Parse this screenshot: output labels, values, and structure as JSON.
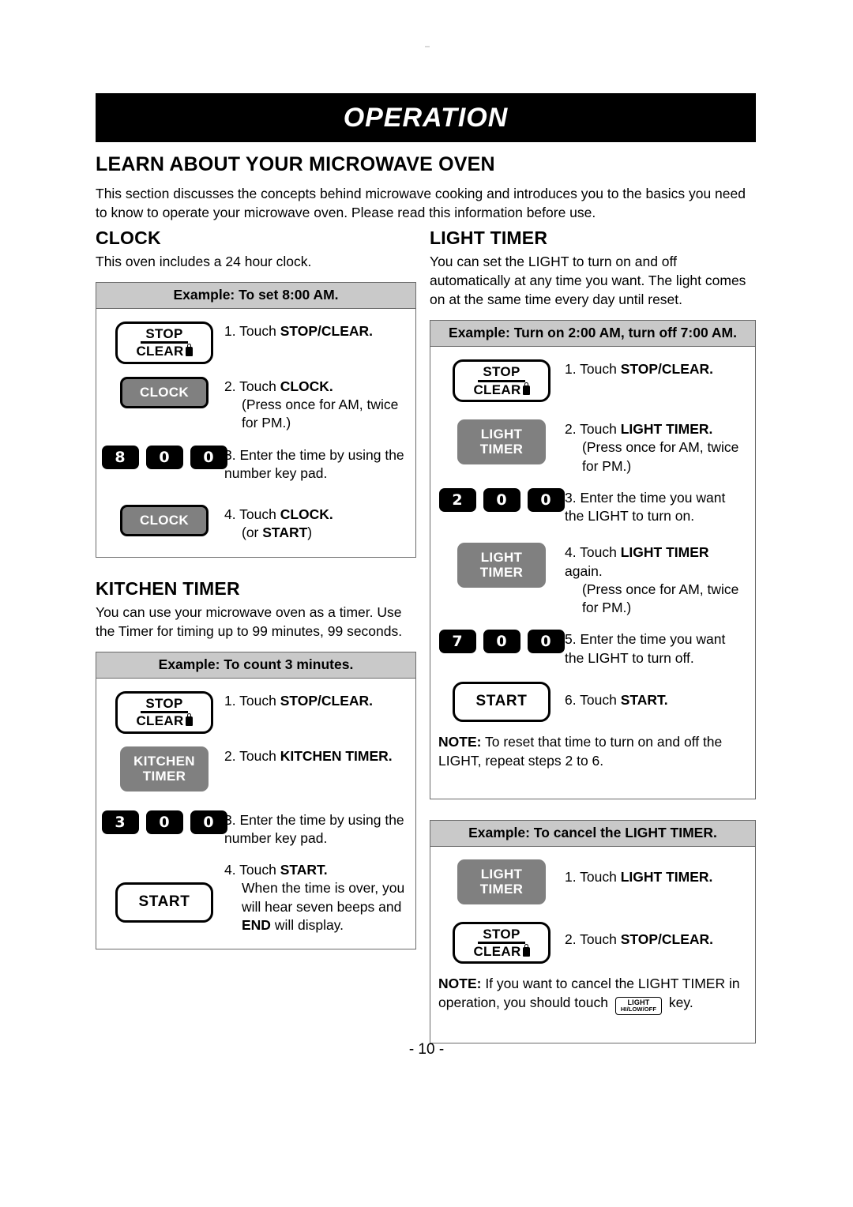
{
  "banner": {
    "title": "OPERATION"
  },
  "intro": {
    "heading": "LEARN ABOUT YOUR MICROWAVE OVEN",
    "body": "This section discusses the concepts behind microwave cooking and introduces you to the basics you need to know to operate your microwave oven. Please read this information before use."
  },
  "keys": {
    "stop": "STOP",
    "clear": "CLEAR",
    "clock": "CLOCK",
    "start": "START",
    "kitchen_timer_l1": "KITCHEN",
    "kitchen_timer_l2": "TIMER",
    "light_timer_l1": "LIGHT",
    "light_timer_l2": "TIMER",
    "light_key_l1": "LIGHT",
    "light_key_l2": "HI/LOW/OFF"
  },
  "clock": {
    "heading": "CLOCK",
    "body": "This oven includes a 24 hour clock.",
    "example_title": "Example: To set 8:00 AM.",
    "digits": [
      "8",
      "0",
      "0"
    ],
    "steps": [
      {
        "num": "1.",
        "main_pre": "Touch ",
        "main_bold": "STOP/CLEAR.",
        "main_post": "",
        "sub": ""
      },
      {
        "num": "2.",
        "main_pre": "Touch ",
        "main_bold": "CLOCK.",
        "main_post": "",
        "sub": "(Press once for AM, twice for PM.)"
      },
      {
        "num": "3.",
        "main_pre": "Enter the time by using the number key pad.",
        "main_bold": "",
        "main_post": "",
        "sub": ""
      },
      {
        "num": "4.",
        "main_pre": "Touch ",
        "main_bold": "CLOCK.",
        "main_post": "",
        "sub_pre": "(or ",
        "sub_bold": "START",
        "sub_post": ")"
      }
    ]
  },
  "kitchen_timer": {
    "heading": "KITCHEN TIMER",
    "body": "You can use your microwave oven as a timer. Use the Timer for timing up to 99 minutes, 99 seconds.",
    "example_title": "Example: To count 3 minutes.",
    "digits": [
      "3",
      "0",
      "0"
    ],
    "steps": [
      {
        "num": "1.",
        "main_pre": "Touch ",
        "main_bold": "STOP/CLEAR.",
        "sub": ""
      },
      {
        "num": "2.",
        "main_pre": "Touch ",
        "main_bold": "KITCHEN TIMER.",
        "sub": ""
      },
      {
        "num": "3.",
        "main_pre": "Enter the time by using the number key pad.",
        "main_bold": "",
        "sub": ""
      },
      {
        "num": "4.",
        "main_pre": "Touch ",
        "main_bold": "START.",
        "sub_pre": "When the time is over, you will hear seven beeps and ",
        "sub_bold": "END",
        "sub_post": " will display."
      }
    ]
  },
  "light_timer": {
    "heading": "LIGHT TIMER",
    "body": "You can set the LIGHT to turn on and off automatically at any time you want. The light comes on at the same time every day until reset.",
    "example_title": "Example: Turn on 2:00 AM, turn off 7:00 AM.",
    "digits_on": [
      "2",
      "0",
      "0"
    ],
    "digits_off": [
      "7",
      "0",
      "0"
    ],
    "steps": [
      {
        "num": "1.",
        "main_pre": "Touch ",
        "main_bold": "STOP/CLEAR.",
        "sub": ""
      },
      {
        "num": "2.",
        "main_pre": "Touch ",
        "main_bold": "LIGHT TIMER.",
        "sub": "(Press once for AM, twice for PM.)"
      },
      {
        "num": "3.",
        "main_pre": "Enter the time you want the LIGHT to turn on.",
        "main_bold": "",
        "sub": ""
      },
      {
        "num": "4.",
        "main_pre": "Touch ",
        "main_bold": "LIGHT TIMER",
        "main_post": " again.",
        "sub": "(Press once for AM, twice for PM.)"
      },
      {
        "num": "5.",
        "main_pre": "Enter the time you want the LIGHT to turn off.",
        "main_bold": "",
        "sub": ""
      },
      {
        "num": "6.",
        "main_pre": "Touch ",
        "main_bold": "START.",
        "sub": ""
      }
    ],
    "note_label": "NOTE:",
    "note_text": " To reset that time to turn on and off the LIGHT, repeat steps 2 to 6."
  },
  "light_timer_cancel": {
    "example_title": "Example: To cancel the LIGHT TIMER.",
    "steps": [
      {
        "num": "1.",
        "main_pre": "Touch ",
        "main_bold": "LIGHT TIMER."
      },
      {
        "num": "2.",
        "main_pre": "Touch ",
        "main_bold": "STOP/CLEAR."
      }
    ],
    "note_label": "NOTE:",
    "note_text_1": " If you want to cancel the LIGHT TIMER in operation, you should touch ",
    "note_text_2": " key."
  },
  "footer": {
    "page_number": "- 10 -"
  },
  "colors": {
    "banner_bg": "#000000",
    "gray_key": "#808080",
    "example_header_bg": "#c9c9c9",
    "box_border": "#6a6a6a"
  }
}
